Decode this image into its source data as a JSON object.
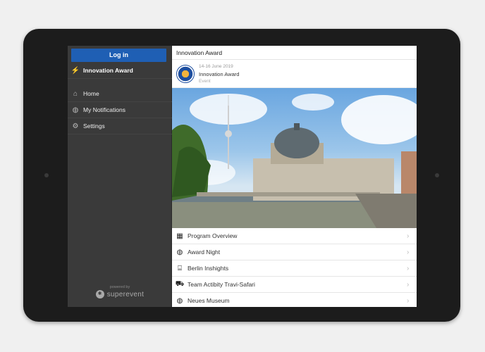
{
  "sidebar": {
    "login_label": "Log in",
    "event_label": "Innovation Award",
    "items": [
      {
        "label": "Home",
        "icon": "home-icon"
      },
      {
        "label": "My Notifications",
        "icon": "globe-icon"
      },
      {
        "label": "Settings",
        "icon": "gear-icon"
      }
    ],
    "powered_by": "powered by",
    "brand": "superevent"
  },
  "header": {
    "title": "Innovation Award"
  },
  "event": {
    "date": "14-16 June 2019",
    "name": "Innovation Award",
    "type": "Event"
  },
  "menu": [
    {
      "label": "Program Overview",
      "icon": "calendar-icon"
    },
    {
      "label": "Award Night",
      "icon": "globe-icon"
    },
    {
      "label": "Berlin Inshights",
      "icon": "museum-icon"
    },
    {
      "label": "Team Actibity Travi-Safari",
      "icon": "car-icon"
    },
    {
      "label": "Neues Museum",
      "icon": "globe-icon"
    }
  ],
  "colors": {
    "login": "#1f5fb4",
    "sidebar": "#3a3a3a"
  }
}
